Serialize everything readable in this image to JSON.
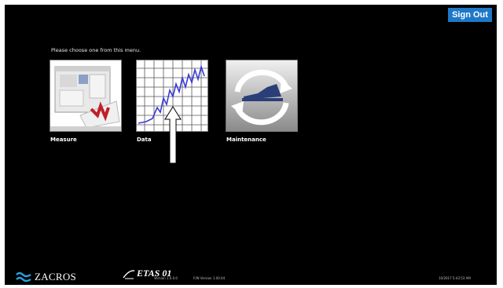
{
  "header": {
    "sign_out_label": "Sign Out"
  },
  "menu": {
    "prompt": "Please choose one from this menu.",
    "tiles": [
      {
        "label": "Measure",
        "icon": "measure-icon"
      },
      {
        "label": "Data",
        "icon": "data-chart-icon"
      },
      {
        "label": "Maintenance",
        "icon": "maintenance-icon"
      }
    ]
  },
  "footer": {
    "brand": "ZACROS",
    "product": "ETAS 01",
    "version": "Version 1.0.0.0",
    "fw_version": "F/W Version 1.00.04",
    "datetime": "10/2017 5:43:53 AM"
  },
  "colors": {
    "background": "#000000",
    "accent": "#1e78c8",
    "chart_line": "#3b3bd8"
  },
  "annotation": {
    "arrow_target": "data"
  }
}
